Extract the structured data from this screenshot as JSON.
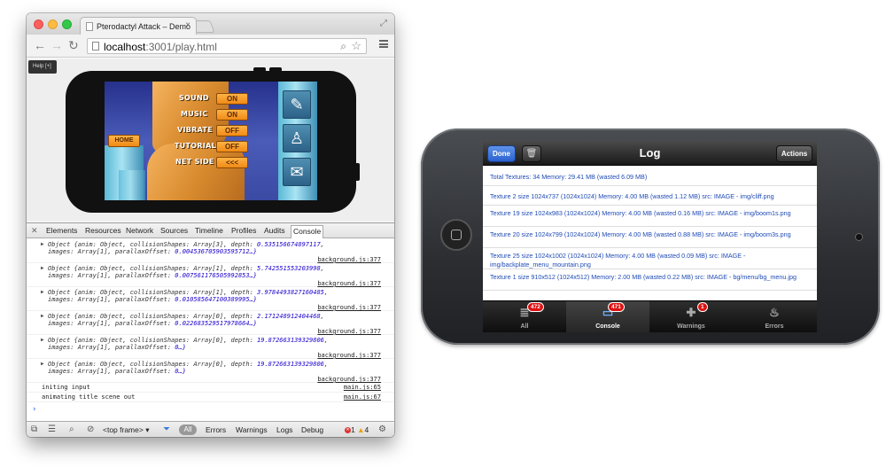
{
  "browser": {
    "tab_title": "Pterodactyl Attack – Demo",
    "url_host": "localhost",
    "url_path": ":3001/play.html"
  },
  "game": {
    "help_label": "Help [+]",
    "home_label": "HOME",
    "settings": [
      {
        "label": "SOUND",
        "value": "ON"
      },
      {
        "label": "MUSIC",
        "value": "ON"
      },
      {
        "label": "VIBRATE",
        "value": "OFF"
      },
      {
        "label": "TUTORIAL",
        "value": "OFF"
      },
      {
        "label": "NET SIDE",
        "value": "<<<"
      }
    ]
  },
  "devtools": {
    "tabs": [
      "Elements",
      "Resources",
      "Network",
      "Sources",
      "Timeline",
      "Profiles",
      "Audits",
      "Console"
    ],
    "active_tab": "Console",
    "entries": [
      {
        "l1a": "Object {anim: Object, collisionShapes: Array[3], depth: ",
        "l1b": "0.535156674897117",
        "l2a": "images: Array[1], parallaxOffset: ",
        "l2b": "0.004536705903595712…}",
        "src": "background.js:377"
      },
      {
        "l1a": "Object {anim: Object, collisionShapes: Array[1], depth: ",
        "l1b": "5.742551553203998",
        "l2a": "images: Array[1], parallaxOffset: ",
        "l2b": "0.007561176505992853…}",
        "src": "background.js:377"
      },
      {
        "l1a": "Object {anim: Object, collisionShapes: Array[1], depth: ",
        "l1b": "3.9784493827160485",
        "l2a": "images: Array[1], parallaxOffset: ",
        "l2b": "0.010585647100389995…}",
        "src": "background.js:377"
      },
      {
        "l1a": "Object {anim: Object, collisionShapes: Array[0], depth: ",
        "l1b": "2.171248912404468",
        "l2a": "images: Array[1], parallaxOffset: ",
        "l2b": "0.022683529517978664…}",
        "src": "background.js:377"
      },
      {
        "l1a": "Object {anim: Object, collisionShapes: Array[0], depth: ",
        "l1b": "19.872663139329806",
        "l2a": "images: Array[1], parallaxOffset: ",
        "l2b": "0…}",
        "src": "background.js:377"
      },
      {
        "l1a": "Object {anim: Object, collisionShapes: Array[0], depth: ",
        "l1b": "19.872663139329806",
        "l2a": "images: Array[1], parallaxOffset: ",
        "l2b": "0…}",
        "src": "background.js:377"
      }
    ],
    "plain_entries": [
      {
        "msg": "initing input",
        "src": "main.js:65"
      },
      {
        "msg": "animating title scene out",
        "src": "main.js:67"
      }
    ],
    "status": {
      "frame": "<top frame>",
      "filter_all": "All",
      "errors": "Errors",
      "warnings": "Warnings",
      "logs": "Logs",
      "debug": "Debug",
      "error_count": "1",
      "warning_count": "4"
    }
  },
  "iphone": {
    "title": "Log",
    "done_label": "Done",
    "actions_label": "Actions",
    "log_rows": [
      "Total Textures: 34 Memory: 29.41 MB (wasted 6.09 MB)",
      "Texture 2 size 1024x737 (1024x1024) Memory: 4.00 MB (wasted 1.12 MB) src: IMAGE - img/cliff.png",
      "Texture 19 size 1024x983 (1024x1024) Memory: 4.00 MB (wasted 0.16 MB) src: IMAGE - img/boom1s.png",
      "Texture 20 size 1024x799 (1024x1024) Memory: 4.00 MB (wasted 0.88 MB) src: IMAGE - img/boom3s.png",
      "Texture 25 size 1024x1002 (1024x1024) Memory: 4.00 MB (wasted 0.09 MB) src: IMAGE - img/backplate_menu_mountain.png",
      "Texture 1 size 910x512 (1024x512) Memory: 2.00 MB (wasted 0.22 MB) src: IMAGE - bg/menu/bg_menu.jpg"
    ],
    "tabs": [
      {
        "label": "All",
        "badge": "472"
      },
      {
        "label": "Console",
        "badge": "471"
      },
      {
        "label": "Warnings",
        "badge": "1"
      },
      {
        "label": "Errors",
        "badge": ""
      }
    ]
  }
}
